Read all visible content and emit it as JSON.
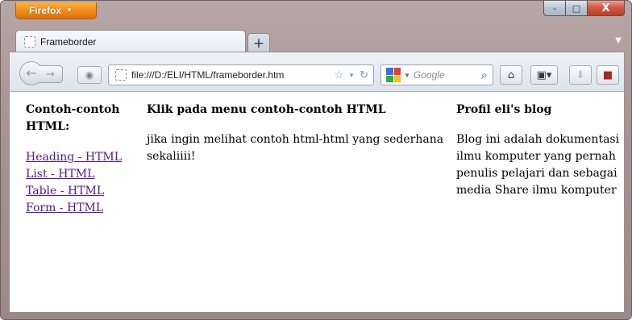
{
  "browser": {
    "menu_button": "Firefox",
    "controls": {
      "minimize": "–",
      "maximize": "□",
      "close": "X"
    }
  },
  "tab": {
    "title": "Frameborder",
    "new_tab": "+"
  },
  "navbar": {
    "url": "file:///D:/ELI/HTML/frameborder.htm",
    "search_placeholder": "Google"
  },
  "frames": {
    "left": {
      "heading": "Contoh-contoh HTML:",
      "links": [
        "Heading - HTML",
        "List - HTML",
        "Table - HTML",
        "Form - HTML"
      ]
    },
    "middle": {
      "heading": "Klik pada menu contoh-contoh HTML",
      "text": "jika ingin melihat contoh html-html yang sederhana sekaliiii!"
    },
    "right": {
      "heading": "Profil eli's blog",
      "text": "Blog ini adalah dokumentasi ilmu komputer yang pernah penulis pelajari dan sebagai media Share ilmu komputer"
    }
  },
  "colors": {
    "firefox_button": "#f08a1a",
    "visited_link": "#551a8b",
    "close_button": "#c03a23"
  },
  "icons": {
    "back": "back-arrow-icon",
    "forward": "forward-arrow-icon",
    "identity": "identity-icon",
    "star": "bookmark-star-icon",
    "reload": "reload-icon",
    "search": "magnifier-icon",
    "home": "home-icon",
    "bookmarks": "bookmarks-icon",
    "download": "download-icon",
    "addon": "addon-icon"
  }
}
